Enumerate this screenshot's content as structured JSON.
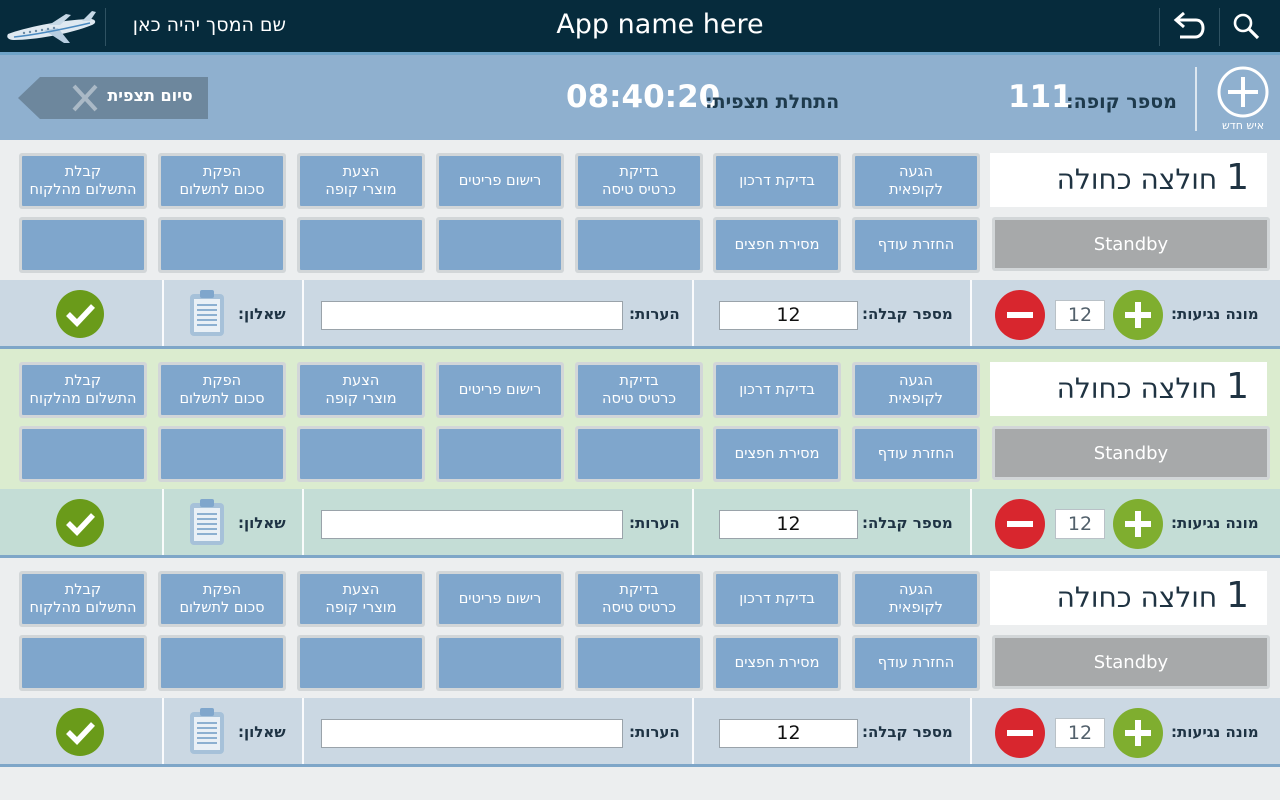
{
  "topbar": {
    "screen_name": "שם המסך יהיה כאן",
    "app_name": "App name here"
  },
  "infobar": {
    "end_observation": "סיום תצפית",
    "start_label": "התחלת תצפית:",
    "start_time": "08:40:20",
    "register_label": "מספר קופה:",
    "register_number": "111",
    "new_person": "איש חדש"
  },
  "sections": [
    {
      "number": "1",
      "name": "חולצה כחולה",
      "standby": "Standby",
      "buttons_row1": [
        "קבלת\nהתשלום מהלקוח",
        "הפקת\nסכום לתשלום",
        "הצעת\nמוצרי קופה",
        "רישום פריטים",
        "בדיקת\nכרטיס טיסה",
        "בדיקת דרכון",
        "הגעה\nלקופאית"
      ],
      "buttons_row2": [
        "",
        "",
        "",
        "",
        "",
        "מסירת חפצים",
        "החזרת עודף"
      ],
      "counter_label": "מונה נגיעות:",
      "counter_value": "12",
      "receipt_label": "מספר קבלה:",
      "receipt_value": "12",
      "notes_label": "הערות:",
      "questionnaire_label": "שאלון:"
    },
    {
      "number": "1",
      "name": "חולצה כחולה",
      "standby": "Standby",
      "buttons_row1": [
        "קבלת\nהתשלום מהלקוח",
        "הפקת\nסכום לתשלום",
        "הצעת\nמוצרי קופה",
        "רישום פריטים",
        "בדיקת\nכרטיס טיסה",
        "בדיקת דרכון",
        "הגעה\nלקופאית"
      ],
      "buttons_row2": [
        "",
        "",
        "",
        "",
        "",
        "מסירת חפצים",
        "החזרת עודף"
      ],
      "counter_label": "מונה נגיעות:",
      "counter_value": "12",
      "receipt_label": "מספר קבלה:",
      "receipt_value": "12",
      "notes_label": "הערות:",
      "questionnaire_label": "שאלון:"
    },
    {
      "number": "1",
      "name": "חולצה כחולה",
      "standby": "Standby",
      "buttons_row1": [
        "קבלת\nהתשלום מהלקוח",
        "הפקת\nסכום לתשלום",
        "הצעת\nמוצרי קופה",
        "רישום פריטים",
        "בדיקת\nכרטיס טיסה",
        "בדיקת דרכון",
        "הגעה\nלקופאית"
      ],
      "buttons_row2": [
        "",
        "",
        "",
        "",
        "",
        "מסירת חפצים",
        "החזרת עודף"
      ],
      "counter_label": "מונה נגיעות:",
      "counter_value": "12",
      "receipt_label": "מספר קבלה:",
      "receipt_value": "12",
      "notes_label": "הערות:",
      "questionnaire_label": "שאלון:"
    }
  ],
  "colors": {
    "topbar": "#062b3c",
    "infobar": "#8fb0cf",
    "button": "#7fa6cc",
    "standby": "#a7a9aa",
    "plus_green": "#7fae2f",
    "minus_red": "#d8262e",
    "check_green": "#6a9b1a",
    "section_bgs": [
      "#eceeef",
      "#dbeccf",
      "#eceeef"
    ],
    "ctrl_bgs": [
      "#cbd8e3",
      "#c4ddd6",
      "#cbd8e3"
    ]
  },
  "icons": {
    "logo": "airplane-icon",
    "back": "undo-arrow-icon",
    "search": "search-icon",
    "close": "close-x-icon",
    "new_person": "plus-circle-icon",
    "plus": "plus-icon",
    "minus": "minus-icon",
    "clipboard": "clipboard-icon",
    "check": "checkmark-icon"
  }
}
